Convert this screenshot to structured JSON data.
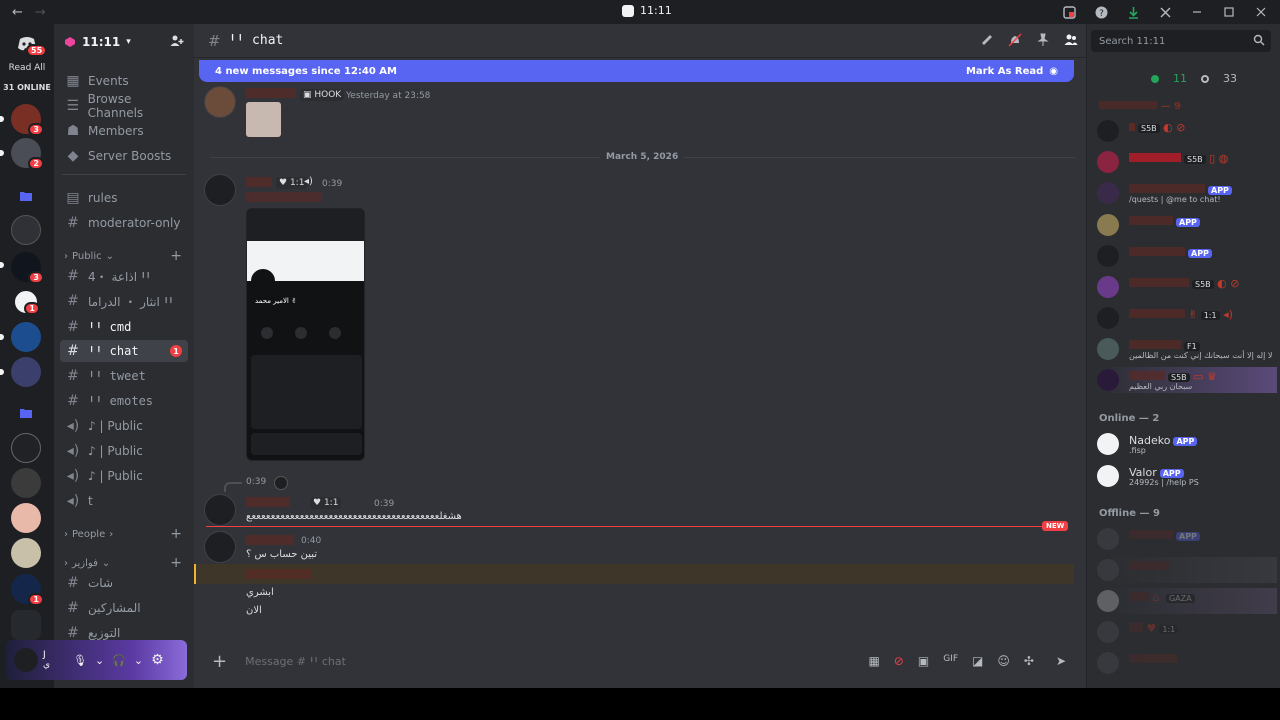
{
  "window": {
    "title": "11:11",
    "nav_back": "←",
    "nav_forward": "→"
  },
  "rail": {
    "home_badge": "55",
    "read_all": "Read All",
    "online_count": "31 ONLINE",
    "servers": [
      {
        "badge": "3"
      },
      {
        "badge": "2"
      },
      {
        "badge": ""
      },
      {
        "badge": ""
      },
      {
        "badge": "3"
      },
      {
        "badge": "1"
      },
      {
        "badge": ""
      },
      {
        "badge": ""
      },
      {
        "badge": ""
      },
      {
        "badge": ""
      },
      {
        "badge": ""
      },
      {
        "badge": ""
      },
      {
        "badge": "1"
      },
      {
        "badge": ""
      }
    ]
  },
  "guild": {
    "name": "11:11",
    "menu": {
      "events": "Events",
      "browse": "Browse Channels",
      "members": "Members",
      "boosts": "Server Boosts"
    },
    "channels_top": [
      {
        "name": "rules"
      },
      {
        "name": "moderator-only"
      }
    ],
    "categories": {
      "public": "Public",
      "people": "People",
      "arabic": "فوازير"
    },
    "public_channels": [
      {
        "name": "اذاعة ・4 ꞋꞋ"
      },
      {
        "name": "انثار ・ الدراما ꞋꞋ"
      },
      {
        "name": "ꞋꞋ cmd"
      },
      {
        "name": "ꞋꞋ chat",
        "badge": "1"
      },
      {
        "name": "ꞋꞋ tweet"
      },
      {
        "name": "ꞋꞋ emotes"
      },
      {
        "name": "♪ | Public"
      },
      {
        "name": "♪ | Public"
      },
      {
        "name": "♪ | Public"
      },
      {
        "name": "t"
      }
    ],
    "arabic_channels": [
      {
        "name": "شات"
      },
      {
        "name": "المشاركين"
      },
      {
        "name": "التوزيع"
      }
    ]
  },
  "user_panel": {
    "name": "J",
    "subtext": "ي"
  },
  "chat": {
    "channel_name": "ꞋꞋ chat",
    "new_messages_banner": "4 new messages since 12:40 AM",
    "mark_as_read": "Mark As Read",
    "date_divider": "March 5, 2026",
    "messages": [
      {
        "tag": "HOOK",
        "time": "Yesterday at 23:58"
      },
      {
        "tag": "1:1",
        "time": "0:39"
      },
      {
        "reply_time": "0:39",
        "tag": "1:1",
        "time": "0:39",
        "text": "هشغلعععععععععععععععععععععععععععععععععععععععع"
      },
      {
        "time": "0:40",
        "text": "تبين حساب س ؟"
      }
    ],
    "extra_lines": [
      "ابشري",
      "الان"
    ],
    "new_tag": "NEW",
    "composer_placeholder": "Message # ꞋꞋ chat",
    "phone_profile_name": "الامير محمد ✌"
  },
  "members": {
    "search_placeholder": "Search 11:11",
    "online_count": "11",
    "total_count": "33",
    "group_role": "— 9",
    "group_online": "Online — 2",
    "group_offline": "Offline — 9",
    "role_members": [
      {
        "badge": "S5B"
      },
      {
        "badge": "S5B"
      },
      {
        "app": "APP",
        "sub": "/quests | @me to chat!"
      },
      {
        "app": "APP"
      },
      {
        "app": "APP"
      },
      {
        "badge": "S5B"
      },
      {
        "badge": "1:1"
      },
      {
        "badge": "F1",
        "sub": "لا إله إلا أنت سبحانك إني كنت من الظالمين"
      },
      {
        "badge": "S5B",
        "sub": "سبحان ربي العظيم"
      }
    ],
    "online_members": [
      {
        "name": "Nadeko",
        "app": "APP",
        "sub": ".fisp"
      },
      {
        "name": "Valor",
        "app": "APP",
        "sub": "24992s | /help PS"
      }
    ],
    "offline_members": [
      {
        "app": "APP"
      },
      {
        "badge": ""
      },
      {
        "badge": "GAZA"
      },
      {
        "badge": "1:1"
      },
      {
        "badge": ""
      }
    ]
  }
}
